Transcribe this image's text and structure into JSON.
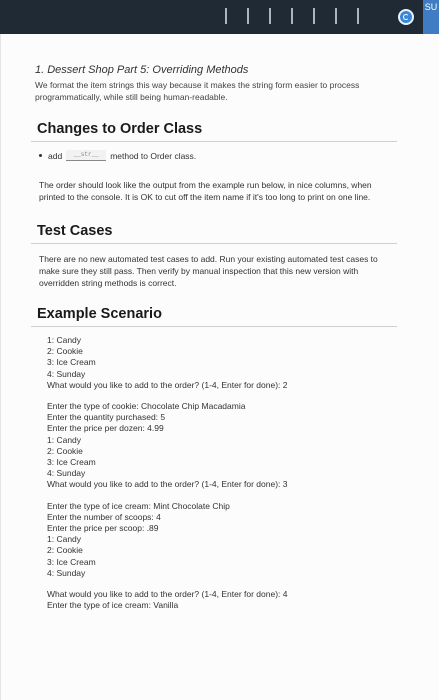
{
  "topbar": {
    "badge_text": "SU"
  },
  "assignment": {
    "title": "1. Dessert Shop Part 5: Overriding Methods",
    "subtitle": "We format the item strings this way because it makes the string form easier to process programmatically, while still being human-readable."
  },
  "changes": {
    "heading": "Changes to Order Class",
    "bullet_pre": "add",
    "code_label": "__str__",
    "bullet_post": "method to Order class.",
    "paragraph": "The order should look like the output from the example run below, in nice columns, when printed to the console. It is OK to cut off the item name if it's too long to print on one line."
  },
  "tests": {
    "heading": "Test Cases",
    "paragraph": "There are no new automated test cases to add. Run your existing automated test cases to make sure they still pass. Then verify by manual inspection that this new version with overridden string methods is correct."
  },
  "example": {
    "heading": "Example Scenario",
    "lines": [
      "1: Candy",
      "2: Cookie",
      "3: Ice Cream",
      "4: Sunday",
      "What would you like to add to the order? (1-4, Enter for done): 2",
      "",
      "Enter the type of cookie: Chocolate Chip Macadamia",
      "Enter the quantity purchased: 5",
      "Enter the price per dozen: 4.99",
      "1: Candy",
      "2: Cookie",
      "3: Ice Cream",
      "4: Sunday",
      "What would you like to add to the order? (1-4, Enter for done): 3",
      "",
      "Enter the type of ice cream: Mint Chocolate Chip",
      "Enter the number of scoops: 4",
      "Enter the price per scoop: .89",
      "1: Candy",
      "2: Cookie",
      "3: Ice Cream",
      "4: Sunday",
      "",
      "What would you like to add to the order? (1-4, Enter for done): 4",
      "Enter the type of ice cream: Vanilla"
    ]
  },
  "colors": {
    "topbar": "#1f2a35",
    "accent_blue": "#3a87d8"
  }
}
